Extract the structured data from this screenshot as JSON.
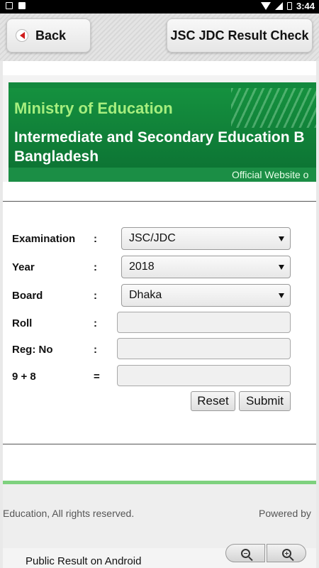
{
  "status_bar": {
    "time": "3:44"
  },
  "app_bar": {
    "back_label": "Back",
    "title": "JSC JDC Result Check"
  },
  "banner": {
    "ministry": "Ministry of Education",
    "board_line1": "Intermediate and Secondary Education B",
    "board_line2": "Bangladesh",
    "subtitle": "Official Website o"
  },
  "form": {
    "examination": {
      "label": "Examination",
      "colon": ":",
      "value": "JSC/JDC"
    },
    "year": {
      "label": "Year",
      "colon": ":",
      "value": "2018"
    },
    "board": {
      "label": "Board",
      "colon": ":",
      "value": "Dhaka"
    },
    "roll": {
      "label": "Roll",
      "colon": ":",
      "value": ""
    },
    "reg_no": {
      "label": "Reg: No",
      "colon": ":",
      "value": ""
    },
    "captcha": {
      "label": "9 + 8",
      "colon": "=",
      "value": ""
    },
    "reset_label": "Reset",
    "submit_label": "Submit"
  },
  "footer": {
    "copyright": "Education, All rights reserved.",
    "powered_by": "Powered by",
    "bottom_text": "Public Result on Android"
  },
  "colors": {
    "banner_green": "#0b7031",
    "ministry_text": "#a6ee7e",
    "footer_rule": "#7ed17e"
  }
}
